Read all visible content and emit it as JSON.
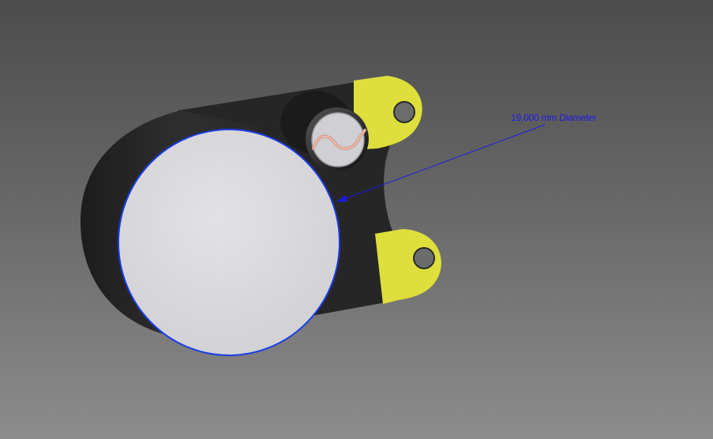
{
  "viewport": {
    "background_top": "#4c4c4c",
    "background_bottom": "#8c8c8c"
  },
  "model": {
    "body_color": "#2a2a2a",
    "face_color": "#dcdcdc",
    "tab_color": "#dede3c",
    "wire_color": "#d49a8a"
  },
  "annotation": {
    "dimension_text": "19,000 mm Diameter",
    "color": "#1a1ae6",
    "highlighted_edge": "front-face-circle-edge"
  }
}
